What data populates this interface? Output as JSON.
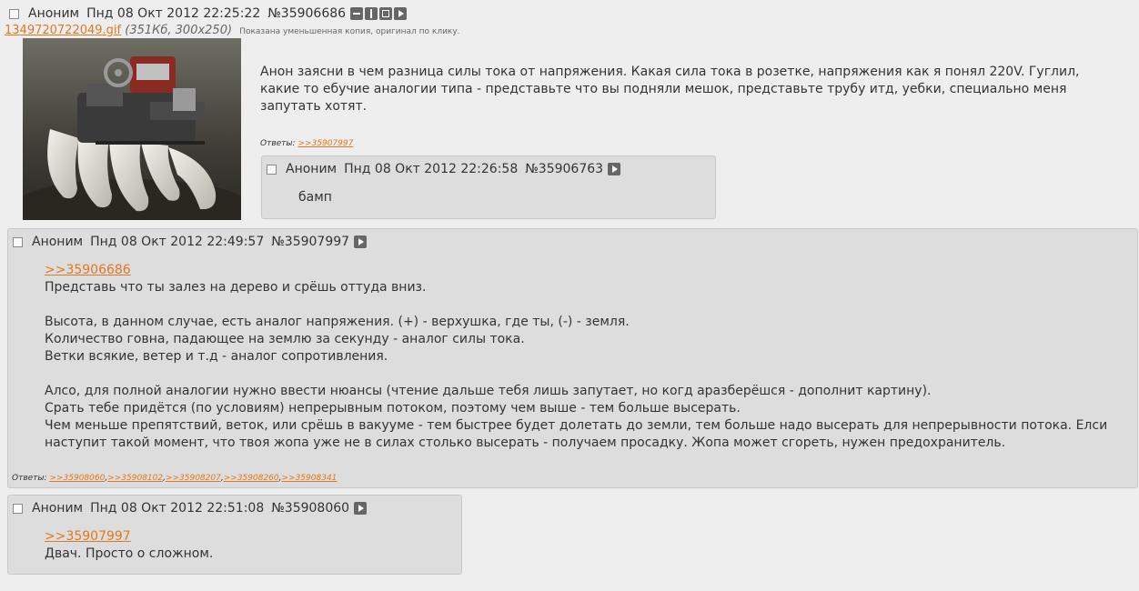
{
  "op": {
    "name": "Аноним",
    "date": "Пнд 08 Окт 2012 22:25:22",
    "num": "№35906686",
    "file": {
      "name": "1349720722049.gif",
      "meta": "351Кб, 300x250",
      "note": "Показана уменьшенная копия, оригинал по клику."
    },
    "text": "Анон заясни в чем разница силы тока от напряжения. Какая сила тока в розетке, напряжения как я понял 220V. Гуглил, какие то ебучие аналогии типа - представьте что вы подняли мешок, представьте трубу итд, уебки, специально меня запутать хотят.",
    "replies_label": "Ответы:",
    "replies": [
      ">>35907997"
    ]
  },
  "posts": [
    {
      "name": "Аноним",
      "date": "Пнд 08 Окт 2012 22:26:58",
      "num": "№35906763",
      "lines": [
        "бамп"
      ]
    },
    {
      "name": "Аноним",
      "date": "Пнд 08 Окт 2012 22:49:57",
      "num": "№35907997",
      "quote": ">>35906686",
      "lines": [
        "Представь что ты залез на дерево и срёшь оттуда вниз.",
        "",
        "Высота, в данном случае, есть аналог напряжения. (+) - верхушка, где ты, (-) - земля.",
        "Количество говна, падающее на землю за секунду - аналог силы тока.",
        "Ветки всякие, ветер и т.д - аналог сопротивления.",
        "",
        "Алсо, для полной аналогии нужно ввести нюансы (чтение дальше тебя лишь запутает, но когд аразберёшся - дополнит картину).",
        "Срать тебе придётся (по условиям) непрерывным потоком, поэтому чем выше - тем больше высерать.",
        "Чем меньше препятствий, веток, или срёшь в вакууме - тем быстрее будет долетать до земли, тем больше надо высерать для непрерывности потока. Елси наступит такой момент, что твоя жопа уже не в силах столько высерать - получаем просадку. Жопа может сгореть, нужен предохранитель."
      ],
      "replies_label": "Ответы:",
      "replies": [
        ">>35908060",
        ">>35908102",
        ">>35908207",
        ">>35908260",
        ">>35908341"
      ]
    },
    {
      "name": "Аноним",
      "date": "Пнд 08 Окт 2012 22:51:08",
      "num": "№35908060",
      "quote": ">>35907997",
      "lines": [
        "Двач. Просто о сложном."
      ]
    }
  ],
  "icons": {
    "hide": "minus-icon",
    "expand": "expand-icon",
    "favorite": "favorite-icon",
    "reply": "play-icon"
  },
  "colors": {
    "link": "#e07920",
    "reply_bg": "#dddddd",
    "page_bg": "#eeeeee"
  }
}
